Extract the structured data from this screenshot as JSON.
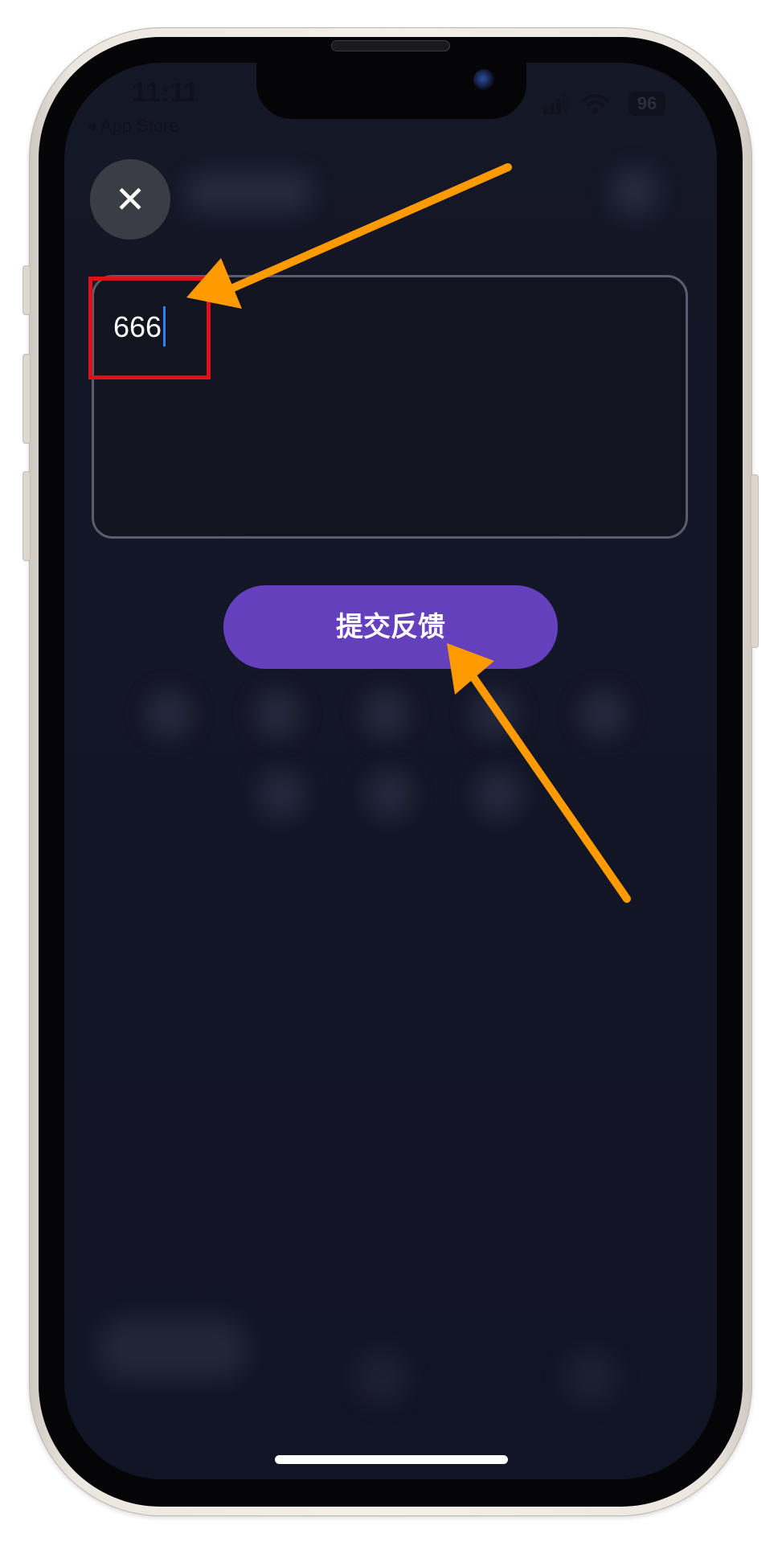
{
  "status_bar": {
    "time": "11:11",
    "back_label": "App Store",
    "back_glyph": "◀",
    "battery": "96",
    "icons": [
      "signal-icon",
      "wifi-icon",
      "battery-icon"
    ]
  },
  "header": {
    "close_glyph": "✕",
    "close_icon": "close-icon"
  },
  "feedback": {
    "input_value": "666"
  },
  "submit": {
    "label": "提交反馈"
  },
  "colors": {
    "screen_bg": "#131627",
    "submit_bg": "#6540bd",
    "highlight": "#e0101a",
    "annotation_arrow": "#ff9a00",
    "caret": "#2f80ff"
  }
}
